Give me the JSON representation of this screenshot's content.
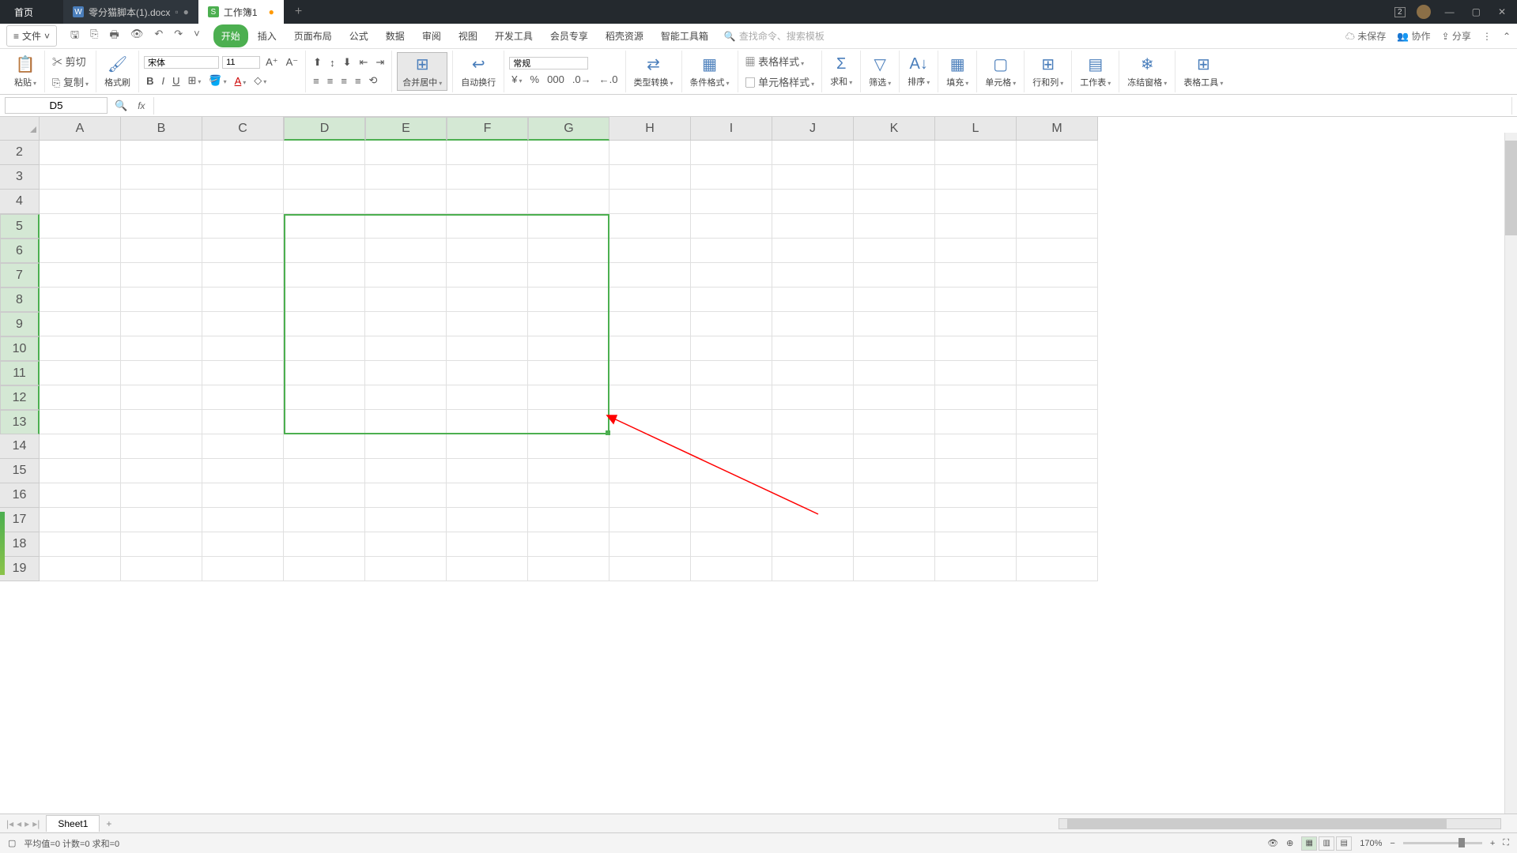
{
  "titlebar": {
    "home": "首页",
    "tab1": {
      "name": "零分猫脚本(1).docx"
    },
    "tab2": {
      "name": "工作簿1"
    },
    "badge": "2"
  },
  "menubar": {
    "file": "文件",
    "tabs": [
      "开始",
      "插入",
      "页面布局",
      "公式",
      "数据",
      "审阅",
      "视图",
      "开发工具",
      "会员专享",
      "稻壳资源",
      "智能工具箱"
    ],
    "search_placeholder": "查找命令、搜索模板",
    "unsaved": "未保存",
    "collab": "协作",
    "share": "分享"
  },
  "ribbon": {
    "paste": "粘贴",
    "cut": "剪切",
    "copy": "复制",
    "fmtpaint": "格式刷",
    "font_name": "宋体",
    "font_size": "11",
    "merge": "合并居中",
    "wrap": "自动换行",
    "numfmt": "常规",
    "typeconv": "类型转换",
    "condfmt": "条件格式",
    "tablestyle": "表格样式",
    "cellstyle": "单元格样式",
    "sum": "求和",
    "filter": "筛选",
    "sort": "排序",
    "fill": "填充",
    "cell": "单元格",
    "rowcol": "行和列",
    "worksheet": "工作表",
    "freeze": "冻结窗格",
    "tabletools": "表格工具"
  },
  "formula": {
    "namebox": "D5"
  },
  "grid": {
    "cols": [
      "A",
      "B",
      "C",
      "D",
      "E",
      "F",
      "G",
      "H",
      "I",
      "J",
      "K",
      "L",
      "M"
    ],
    "rows": [
      2,
      3,
      4,
      5,
      6,
      7,
      8,
      9,
      10,
      11,
      12,
      13,
      14,
      15,
      16,
      17,
      18,
      19
    ],
    "sel_cols": [
      "D",
      "E",
      "F",
      "G"
    ],
    "sel_rows": [
      5,
      6,
      7,
      8,
      9,
      10,
      11,
      12,
      13
    ]
  },
  "sheets": {
    "tab": "Sheet1"
  },
  "status": {
    "stats": "平均值=0  计数=0  求和=0",
    "zoom": "170%"
  }
}
